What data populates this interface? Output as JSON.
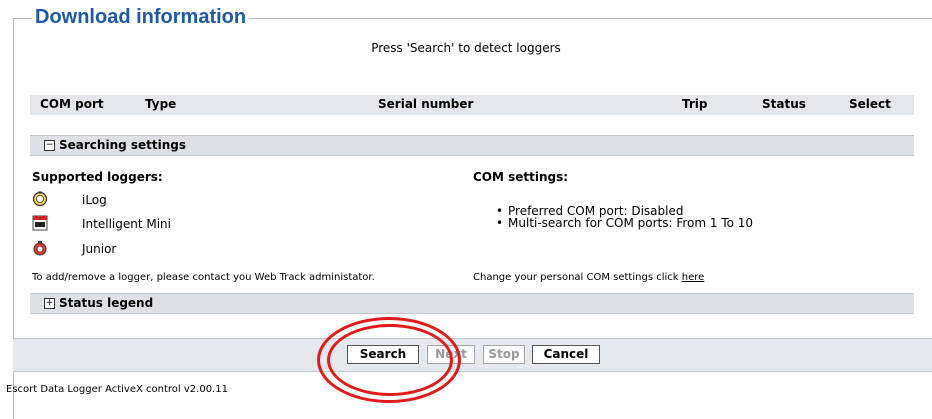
{
  "section_title": "Download information",
  "hint": "Press 'Search' to detect loggers",
  "table": {
    "columns": [
      "COM port",
      "Type",
      "Serial number",
      "Trip",
      "Status",
      "Select"
    ]
  },
  "searching_settings": {
    "toggle": "−",
    "label": "Searching settings",
    "supported_title": "Supported loggers:",
    "loggers": [
      {
        "name": "iLog",
        "icon": "ilog-icon"
      },
      {
        "name": "Intelligent Mini",
        "icon": "intelligent-mini-icon"
      },
      {
        "name": "Junior",
        "icon": "junior-icon"
      }
    ],
    "add_note": "To add/remove a logger, please contact you Web Track administator.",
    "com_title": "COM settings:",
    "com_items": [
      "Preferred COM port: Disabled",
      "Multi-search for COM ports: From 1 To 10"
    ],
    "change_prefix": "Change your personal COM settings click ",
    "change_link": "here"
  },
  "status_legend": {
    "toggle": "+",
    "label": "Status legend"
  },
  "buttons": {
    "search": "Search",
    "next": "Next",
    "stop": "Stop",
    "cancel": "Cancel"
  },
  "footer": "Escort Data Logger ActiveX control v2.00.11",
  "colors": {
    "title": "#1c5aa8",
    "bar": "#dde1e6",
    "annotation_circle": "#e11a1a"
  }
}
